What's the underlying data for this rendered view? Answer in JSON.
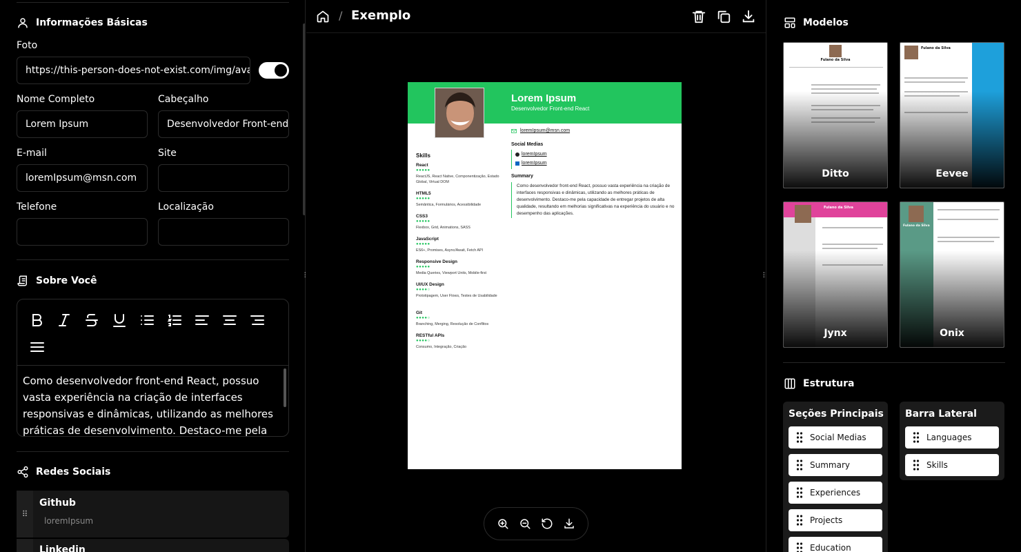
{
  "left": {
    "basic_info": {
      "title": "Informações Básicas",
      "photo_label": "Foto",
      "photo_value": "https://this-person-does-not-exist.com/img/avatar",
      "fullname_label": "Nome Completo",
      "fullname_value": "Lorem Ipsum",
      "header_label": "Cabeçalho",
      "header_value": "Desenvolvedor Front-end",
      "email_label": "E-mail",
      "email_value": "loremIpsum@msn.com",
      "site_label": "Site",
      "site_value": "",
      "phone_label": "Telefone",
      "phone_value": "",
      "location_label": "Localização",
      "location_value": ""
    },
    "about": {
      "title": "Sobre Você",
      "text": "Como desenvolvedor front-end React, possuo vasta experiência na criação de interfaces responsivas e dinâmicas, utilizando as melhores práticas de desenvolvimento. Destaco-me pela capacidade de"
    },
    "social": {
      "title": "Redes Sociais",
      "items": [
        {
          "name": "Github",
          "user": "loremIpsum"
        },
        {
          "name": "Linkedin",
          "user": ""
        }
      ]
    }
  },
  "center": {
    "breadcrumb_title": "Exemplo",
    "resume": {
      "name": "Lorem Ipsum",
      "role": "Desenvolvedor Front-end React",
      "email": "loremIpsum@msn.com",
      "social_title": "Social Medias",
      "social_links": [
        "loremIpsum",
        "loremIpsum"
      ],
      "summary_title": "Summary",
      "summary": "Como desenvolvedor front-end React, possuo vasta experiência na criação de interfaces responsivas e dinâmicas, utilizando as melhores práticas de desenvolvimento. Destaco-me pela capacidade de entregar projetos de alta qualidade, resultando em melhorias significativas na experiência do usuário e no desempenho das aplicações.",
      "skills_title": "Skills",
      "skills": [
        {
          "name": "React",
          "dots": "●●●●●",
          "desc": "ReactJS, React Native, Componentização, Estado Global, Virtual DOM"
        },
        {
          "name": "HTML5",
          "dots": "●●●●●",
          "desc": "Semântica, Formulários, Acessibilidade"
        },
        {
          "name": "CSS3",
          "dots": "●●●●●",
          "desc": "Flexbox, Grid, Animations, SASS"
        },
        {
          "name": "JavaScript",
          "dots": "●●●●●",
          "desc": "ES6+, Promises, Async/Await, Fetch API"
        },
        {
          "name": "Responsive Design",
          "dots": "●●●●●",
          "desc": "Media Queries, Viewport Units, Mobile-first"
        },
        {
          "name": "UI/UX Design",
          "dots": "●●●●○",
          "desc": "Prototipagem, User Flows, Testes de Usabilidade"
        },
        {
          "name": "Git",
          "dots": "●●●●○",
          "desc": "Branching, Merging, Resolução de Conflitos"
        },
        {
          "name": "RESTful APIs",
          "dots": "●●●●○",
          "desc": "Consumo, Integração, Criação"
        }
      ]
    }
  },
  "right": {
    "models_title": "Modelos",
    "templates": [
      "Ditto",
      "Eevee",
      "Jynx",
      "Onix"
    ],
    "thumb_name": "Fulano da Silva",
    "structure_title": "Estrutura",
    "main_sections_title": "Seções Principais",
    "main_sections": [
      "Social Medias",
      "Summary",
      "Experiences",
      "Projects",
      "Education"
    ],
    "sidebar_title": "Barra Lateral",
    "sidebar_sections": [
      "Languages",
      "Skills"
    ]
  },
  "colors": {
    "accent_green": "#22c55e",
    "jynx_pink": "#e0439b",
    "eevee_blue": "#1ea0db",
    "onix_teal": "#5a9a86"
  }
}
